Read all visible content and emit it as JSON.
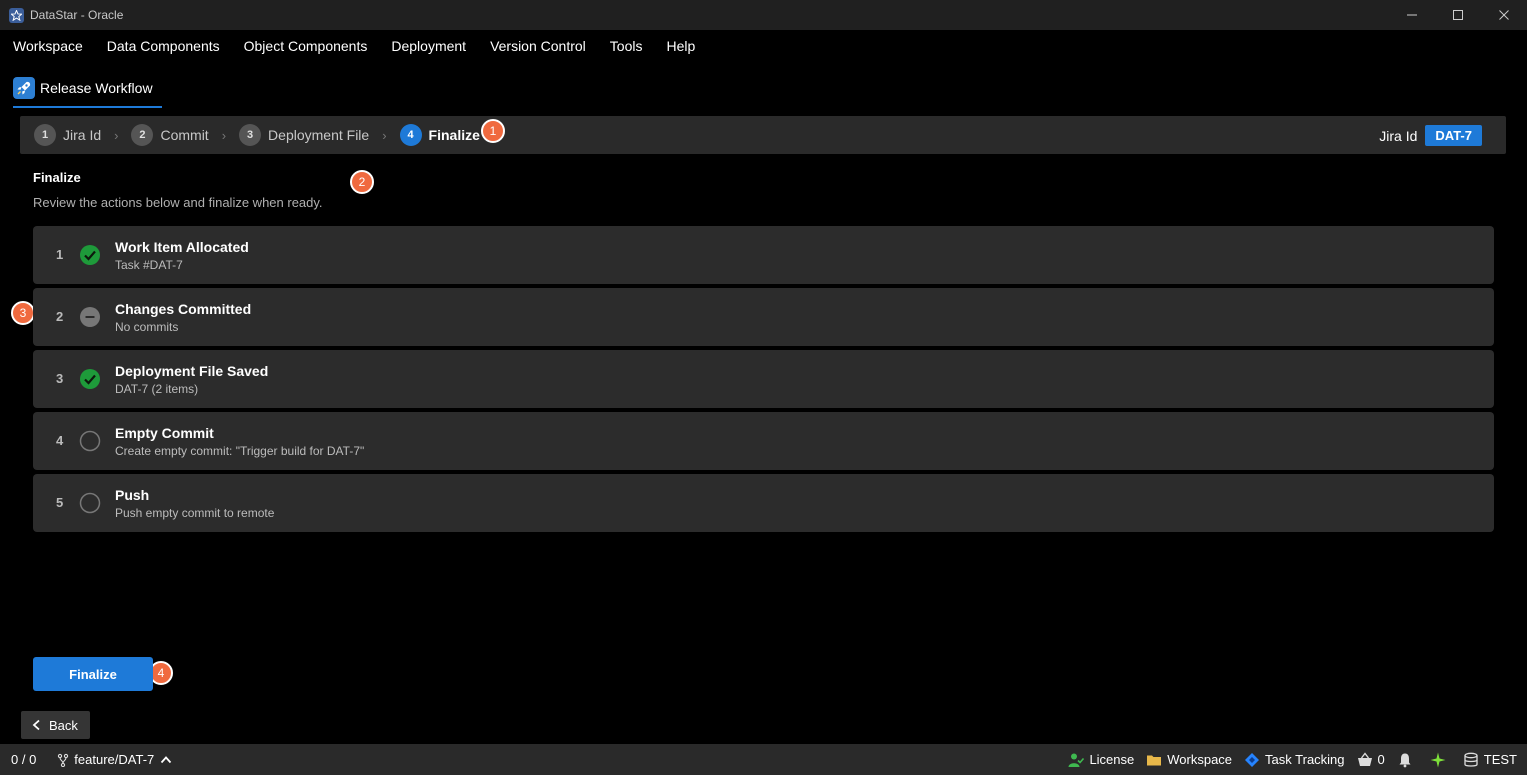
{
  "window": {
    "title": "DataStar - Oracle"
  },
  "menu": [
    "Workspace",
    "Data Components",
    "Object Components",
    "Deployment",
    "Version Control",
    "Tools",
    "Help"
  ],
  "tab": {
    "label": "Release Workflow"
  },
  "stepper": {
    "steps": [
      {
        "num": "1",
        "label": "Jira Id"
      },
      {
        "num": "2",
        "label": "Commit"
      },
      {
        "num": "3",
        "label": "Deployment File"
      },
      {
        "num": "4",
        "label": "Finalize"
      }
    ],
    "separator": "›",
    "jira_label": "Jira Id",
    "jira_value": "DAT-7"
  },
  "markers": [
    "1",
    "2",
    "3",
    "4"
  ],
  "section": {
    "title": "Finalize",
    "subtitle": "Review the actions below and finalize when ready."
  },
  "actions": [
    {
      "num": "1",
      "title": "Work Item Allocated",
      "sub": "Task #DAT-7",
      "status": "done"
    },
    {
      "num": "2",
      "title": "Changes Committed",
      "sub": "No commits",
      "status": "skipped"
    },
    {
      "num": "3",
      "title": "Deployment File Saved",
      "sub": "DAT-7 (2 items)",
      "status": "done"
    },
    {
      "num": "4",
      "title": "Empty Commit",
      "sub": "Create empty commit: \"Trigger build for DAT-7\"",
      "status": "pending"
    },
    {
      "num": "5",
      "title": "Push",
      "sub": "Push empty commit to remote",
      "status": "pending"
    }
  ],
  "buttons": {
    "finalize": "Finalize",
    "back": "Back"
  },
  "statusbar": {
    "counter": "0 / 0",
    "branch": "feature/DAT-7",
    "license": "License",
    "workspace": "Workspace",
    "task_tracking": "Task Tracking",
    "notifications_count": "0",
    "env": "TEST"
  },
  "colors": {
    "accent": "#1e7ad8",
    "success": "#1e9a3a",
    "marker": "#f06a3f"
  }
}
